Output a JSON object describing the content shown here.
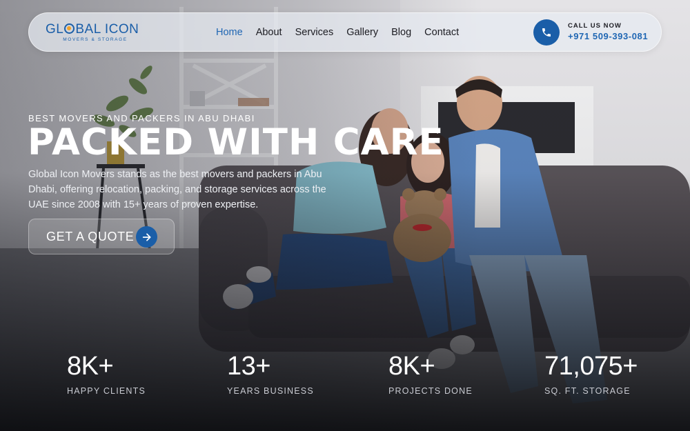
{
  "brand": {
    "name_pre": "GL",
    "name_post": "BAL ICON",
    "tagline": "MOVERS & STORAGE",
    "color": "#1a5ea8"
  },
  "nav": {
    "items": [
      {
        "label": "Home",
        "active": true
      },
      {
        "label": "About"
      },
      {
        "label": "Services"
      },
      {
        "label": "Gallery"
      },
      {
        "label": "Blog"
      },
      {
        "label": "Contact"
      }
    ]
  },
  "contact": {
    "icon": "phone-icon",
    "label": "CALL US NOW",
    "number": "+971 509-393-081"
  },
  "hero": {
    "eyebrow": "BEST MOVERS AND PACKERS IN ABU DHABI",
    "headline": "PACKED WITH CARE",
    "description": "Global Icon Movers stands as the best movers and packers in Abu Dhabi, offering relocation, packing, and storage services across the UAE since 2008 with 15+ years of proven expertise.",
    "cta_label": "GET A QUOTE",
    "cta_icon": "arrow-right-icon"
  },
  "stats": [
    {
      "value": "8K+",
      "label": "HAPPY CLIENTS"
    },
    {
      "value": "13+",
      "label": "YEARS BUSINESS"
    },
    {
      "value": "8K+",
      "label": "PROJECTS DONE"
    },
    {
      "value": "71,075+",
      "label": "SQ. FT. STORAGE"
    }
  ],
  "colors": {
    "accent": "#1a5ea8",
    "nav_active": "#1f66b3",
    "text_light": "#ffffff"
  }
}
